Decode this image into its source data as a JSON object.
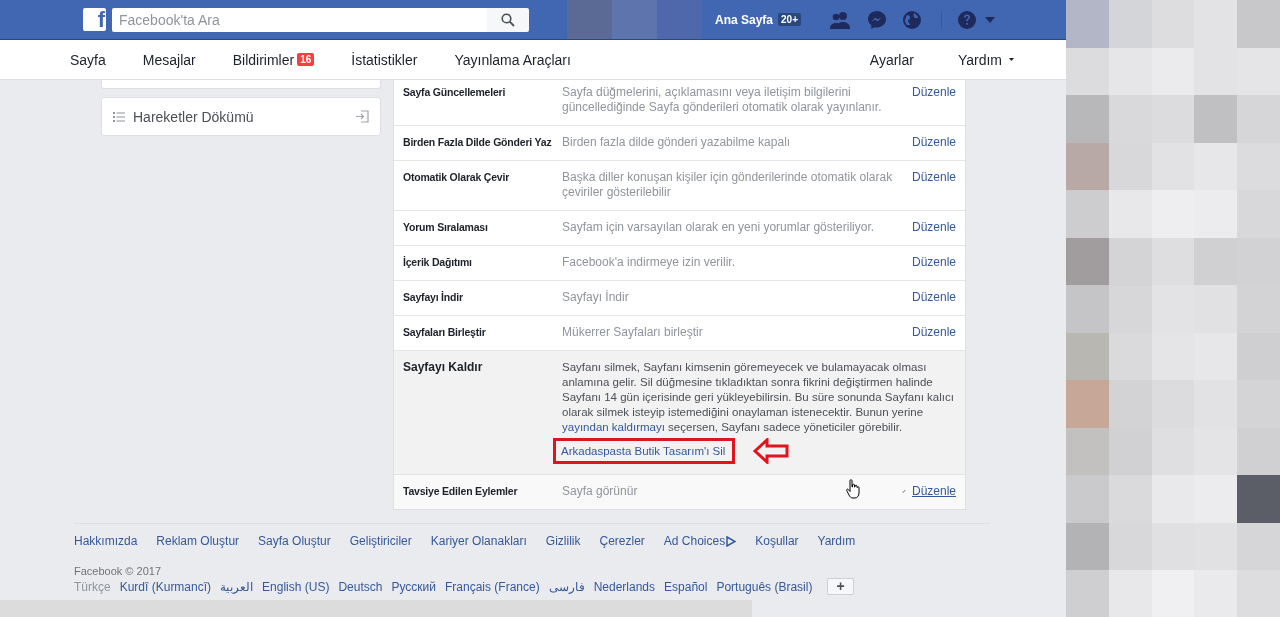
{
  "top_bar": {
    "logo": "f",
    "search": {
      "placeholder": "Facebook'ta Ara"
    },
    "home": "Ana Sayfa",
    "home_badge": "20+"
  },
  "page_nav": {
    "tabs": [
      {
        "label": "Sayfa"
      },
      {
        "label": "Mesajlar"
      },
      {
        "label": "Bildirimler",
        "badge": "16"
      },
      {
        "label": "İstatistikler"
      },
      {
        "label": "Yayınlama Araçları"
      }
    ],
    "right": [
      {
        "label": "Ayarlar",
        "dropdown": false
      },
      {
        "label": "Yardım",
        "dropdown": true
      }
    ]
  },
  "sidebar": {
    "items": [
      {
        "label": "Hareketler Dökümü"
      }
    ]
  },
  "settings": [
    {
      "label": "Sayfa Güncellemeleri",
      "description": [
        {
          "text": "Sayfa düğmelerini, açıklamasını veya iletişim bilgilerini güncellediğinde Sayfa gönderileri otomatik olarak yayınlanır.",
          "link": false
        }
      ],
      "edit": "Düzenle",
      "expanded": false,
      "hovered": false
    },
    {
      "label": "Birden Fazla Dilde Gönderi Yaz",
      "description": [
        {
          "text": "Birden fazla dilde gönderi yazabilme kapalı",
          "link": false
        }
      ],
      "edit": "Düzenle",
      "expanded": false,
      "hovered": false
    },
    {
      "label": "Otomatik Olarak Çevir",
      "description": [
        {
          "text": "Başka diller konuşan kişiler için gönderilerinde otomatik olarak çeviriler gösterilebilir",
          "link": false
        }
      ],
      "edit": "Düzenle",
      "expanded": false,
      "hovered": false
    },
    {
      "label": "Yorum Sıralaması",
      "description": [
        {
          "text": "Sayfam için varsayılan olarak en yeni yorumlar gösteriliyor.",
          "link": false
        }
      ],
      "edit": "Düzenle",
      "expanded": false,
      "hovered": false
    },
    {
      "label": "İçerik Dağıtımı",
      "description": [
        {
          "text": "Facebook'a indirmeye izin verilir.",
          "link": false
        }
      ],
      "edit": "Düzenle",
      "expanded": false,
      "hovered": false
    },
    {
      "label": "Sayfayı İndir",
      "description": [
        {
          "text": "Sayfayı İndir",
          "link": false
        }
      ],
      "edit": "Düzenle",
      "expanded": false,
      "hovered": false
    },
    {
      "label": "Sayfaları Birleştir",
      "description": [
        {
          "text": "Mükerrer Sayfaları birleştir",
          "link": false
        }
      ],
      "edit": "Düzenle",
      "expanded": false,
      "hovered": false
    },
    {
      "label": "Sayfayı Kaldır",
      "description": [
        {
          "text": "Sayfanı silmek, Sayfanı kimsenin göremeyecek ve bulamayacak olması anlamına gelir. Sil düğmesine tıkladıktan sonra fikrini değiştirmen halinde Sayfanı 14 gün içerisinde geri yükleyebilirsin. Bu süre sonunda Sayfanı kalıcı olarak silmek isteyip istemediğini onaylaman istenecektir. Bunun yerine ",
          "link": false
        },
        {
          "text": "yayından kaldırmayı",
          "link": true
        },
        {
          "text": " seçersen, Sayfanı sadece yöneticiler görebilir.",
          "link": false
        }
      ],
      "action": "Arkadaspasta Butik Tasarım'ı Sil",
      "expanded": true
    },
    {
      "label": "Tavsiye Edilen Eylemler",
      "description": [
        {
          "text": "Sayfa görünür",
          "link": false
        }
      ],
      "edit": "Düzenle",
      "expanded": false,
      "hovered": true
    }
  ],
  "footer": {
    "links": [
      "Hakkımızda",
      "Reklam Oluştur",
      "Sayfa Oluştur",
      "Geliştiriciler",
      "Kariyer Olanakları",
      "Gizlilik",
      "Çerezler",
      "Ad Choices",
      "Koşullar",
      "Yardım"
    ],
    "copyright": "Facebook © 2017",
    "languages": [
      {
        "label": "Türkçe",
        "selected": true
      },
      {
        "label": "Kurdî (Kurmancî)",
        "selected": false
      },
      {
        "label": "العربية",
        "selected": false
      },
      {
        "label": "English (US)",
        "selected": false
      },
      {
        "label": "Deutsch",
        "selected": false
      },
      {
        "label": "Русский",
        "selected": false
      },
      {
        "label": "Français (France)",
        "selected": false
      },
      {
        "label": "فارسی",
        "selected": false
      },
      {
        "label": "Nederlands",
        "selected": false
      },
      {
        "label": "Español",
        "selected": false
      },
      {
        "label": "Português (Brasil)",
        "selected": false
      }
    ],
    "more": "+"
  }
}
